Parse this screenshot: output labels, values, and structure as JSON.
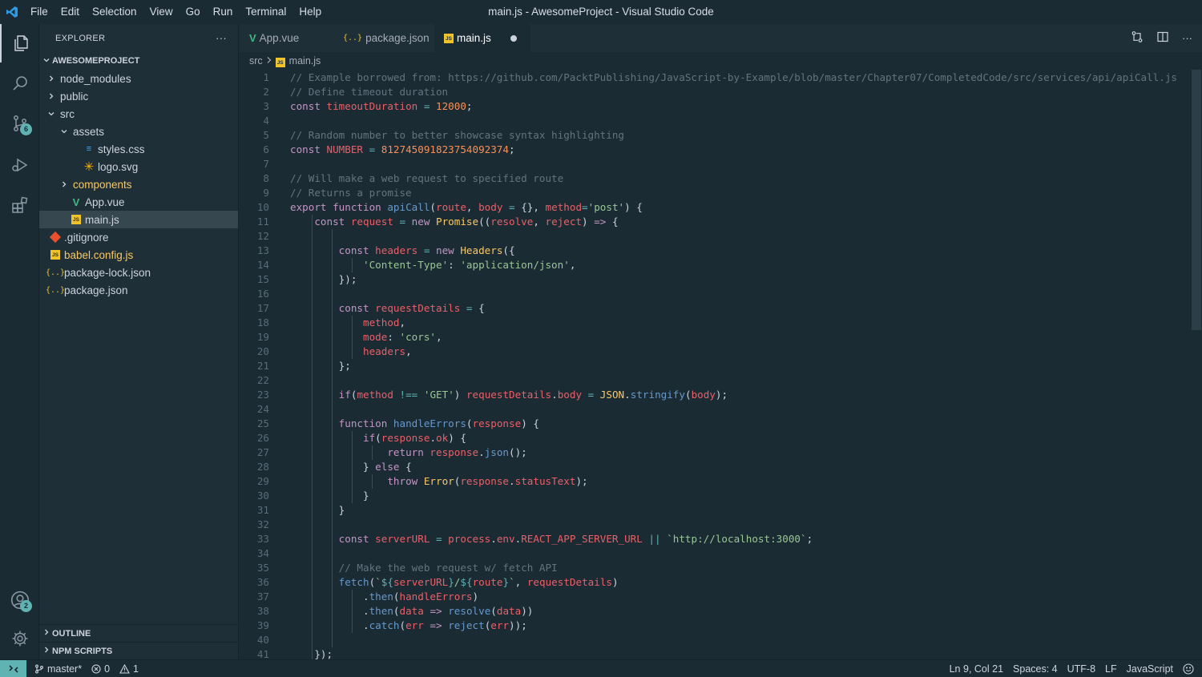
{
  "titlebar": {
    "window_title": "main.js - AwesomeProject - Visual Studio Code",
    "menu": [
      "File",
      "Edit",
      "Selection",
      "View",
      "Go",
      "Run",
      "Terminal",
      "Help"
    ]
  },
  "activity": {
    "scm_badge": "6",
    "accounts_badge": "2"
  },
  "sidebar": {
    "title": "EXPLORER",
    "more_label": "···",
    "project": "AWESOMEPROJECT",
    "tree": [
      {
        "label": "node_modules",
        "kind": "folder-closed",
        "depth": 1,
        "icon": "none"
      },
      {
        "label": "public",
        "kind": "folder-closed",
        "depth": 1,
        "icon": "none"
      },
      {
        "label": "src",
        "kind": "folder-open",
        "depth": 1,
        "icon": "none"
      },
      {
        "label": "assets",
        "kind": "folder-open",
        "depth": 2,
        "icon": "none"
      },
      {
        "label": "styles.css",
        "kind": "file",
        "depth": 3,
        "icon": "css"
      },
      {
        "label": "logo.svg",
        "kind": "file",
        "depth": 3,
        "icon": "svg"
      },
      {
        "label": "components",
        "kind": "folder-closed",
        "depth": 2,
        "icon": "none",
        "color": "#fac863"
      },
      {
        "label": "App.vue",
        "kind": "file",
        "depth": 2,
        "icon": "vue"
      },
      {
        "label": "main.js",
        "kind": "file",
        "depth": 2,
        "icon": "js",
        "selected": true
      },
      {
        "label": ".gitignore",
        "kind": "file",
        "depth": 1,
        "icon": "git"
      },
      {
        "label": "babel.config.js",
        "kind": "file",
        "depth": 1,
        "icon": "js",
        "color": "#fac863"
      },
      {
        "label": "package-lock.json",
        "kind": "file",
        "depth": 1,
        "icon": "json"
      },
      {
        "label": "package.json",
        "kind": "file",
        "depth": 1,
        "icon": "json"
      }
    ],
    "outline_label": "OUTLINE",
    "npm_label": "NPM SCRIPTS"
  },
  "tabs": [
    {
      "label": "App.vue",
      "icon": "vue",
      "active": false
    },
    {
      "label": "package.json",
      "icon": "json",
      "active": false
    },
    {
      "label": "main.js",
      "icon": "js",
      "active": true,
      "dirty": true
    }
  ],
  "breadcrumb": {
    "folder": "src",
    "file": "main.js"
  },
  "code": [
    [
      [
        "c-comment",
        "// Example borrowed from: https://github.com/PacktPublishing/JavaScript-by-Example/blob/master/Chapter07/CompletedCode/src/services/api/apiCall.js"
      ]
    ],
    [
      [
        "c-comment",
        "// Define timeout duration"
      ]
    ],
    [
      [
        "c-kw",
        "const "
      ],
      [
        "c-var",
        "timeoutDuration"
      ],
      [
        "c-op",
        " = "
      ],
      [
        "c-num",
        "12000"
      ],
      [
        "c-punc",
        ";"
      ]
    ],
    [],
    [
      [
        "c-comment",
        "// Random number to better showcase syntax highlighting"
      ]
    ],
    [
      [
        "c-kw",
        "const "
      ],
      [
        "c-var",
        "NUMBER"
      ],
      [
        "c-op",
        " = "
      ],
      [
        "c-num",
        "812745091823754092374"
      ],
      [
        "c-punc",
        ";"
      ]
    ],
    [],
    [
      [
        "c-comment",
        "// Will make a web request to specified route"
      ]
    ],
    [
      [
        "c-comment",
        "// Returns a promise"
      ]
    ],
    [
      [
        "c-kw",
        "export function "
      ],
      [
        "c-fn",
        "apiCall"
      ],
      [
        "c-punc",
        "("
      ],
      [
        "c-var",
        "route"
      ],
      [
        "c-punc",
        ", "
      ],
      [
        "c-var",
        "body"
      ],
      [
        "c-op",
        " = "
      ],
      [
        "c-punc",
        "{}, "
      ],
      [
        "c-var",
        "method"
      ],
      [
        "c-op",
        "="
      ],
      [
        "c-str",
        "'post'"
      ],
      [
        "c-punc",
        ") {"
      ]
    ],
    [
      [
        "c-punc",
        "    "
      ],
      [
        "c-kw",
        "const "
      ],
      [
        "c-var",
        "request"
      ],
      [
        "c-op",
        " = "
      ],
      [
        "c-kw",
        "new "
      ],
      [
        "c-cls",
        "Promise"
      ],
      [
        "c-punc",
        "(("
      ],
      [
        "c-var",
        "resolve"
      ],
      [
        "c-punc",
        ", "
      ],
      [
        "c-var",
        "reject"
      ],
      [
        "c-punc",
        ") "
      ],
      [
        "c-kw",
        "=>"
      ],
      [
        "c-punc",
        " {"
      ]
    ],
    [],
    [
      [
        "c-punc",
        "        "
      ],
      [
        "c-kw",
        "const "
      ],
      [
        "c-var",
        "headers"
      ],
      [
        "c-op",
        " = "
      ],
      [
        "c-kw",
        "new "
      ],
      [
        "c-cls",
        "Headers"
      ],
      [
        "c-punc",
        "({"
      ]
    ],
    [
      [
        "c-punc",
        "            "
      ],
      [
        "c-str",
        "'Content-Type'"
      ],
      [
        "c-punc",
        ": "
      ],
      [
        "c-str",
        "'application/json'"
      ],
      [
        "c-punc",
        ","
      ]
    ],
    [
      [
        "c-punc",
        "        });"
      ]
    ],
    [],
    [
      [
        "c-punc",
        "        "
      ],
      [
        "c-kw",
        "const "
      ],
      [
        "c-var",
        "requestDetails"
      ],
      [
        "c-op",
        " = "
      ],
      [
        "c-punc",
        "{"
      ]
    ],
    [
      [
        "c-punc",
        "            "
      ],
      [
        "c-var",
        "method"
      ],
      [
        "c-punc",
        ","
      ]
    ],
    [
      [
        "c-punc",
        "            "
      ],
      [
        "c-var",
        "mode"
      ],
      [
        "c-punc",
        ": "
      ],
      [
        "c-str",
        "'cors'"
      ],
      [
        "c-punc",
        ","
      ]
    ],
    [
      [
        "c-punc",
        "            "
      ],
      [
        "c-var",
        "headers"
      ],
      [
        "c-punc",
        ","
      ]
    ],
    [
      [
        "c-punc",
        "        };"
      ]
    ],
    [],
    [
      [
        "c-punc",
        "        "
      ],
      [
        "c-kw",
        "if"
      ],
      [
        "c-punc",
        "("
      ],
      [
        "c-var",
        "method"
      ],
      [
        "c-op",
        " !== "
      ],
      [
        "c-str",
        "'GET'"
      ],
      [
        "c-punc",
        ") "
      ],
      [
        "c-var",
        "requestDetails"
      ],
      [
        "c-punc",
        "."
      ],
      [
        "c-var",
        "body"
      ],
      [
        "c-op",
        " = "
      ],
      [
        "c-cls",
        "JSON"
      ],
      [
        "c-punc",
        "."
      ],
      [
        "c-fn",
        "stringify"
      ],
      [
        "c-punc",
        "("
      ],
      [
        "c-var",
        "body"
      ],
      [
        "c-punc",
        ");"
      ]
    ],
    [],
    [
      [
        "c-punc",
        "        "
      ],
      [
        "c-kw",
        "function "
      ],
      [
        "c-fn",
        "handleErrors"
      ],
      [
        "c-punc",
        "("
      ],
      [
        "c-var",
        "response"
      ],
      [
        "c-punc",
        ") {"
      ]
    ],
    [
      [
        "c-punc",
        "            "
      ],
      [
        "c-kw",
        "if"
      ],
      [
        "c-punc",
        "("
      ],
      [
        "c-var",
        "response"
      ],
      [
        "c-punc",
        "."
      ],
      [
        "c-var",
        "ok"
      ],
      [
        "c-punc",
        ") {"
      ]
    ],
    [
      [
        "c-punc",
        "                "
      ],
      [
        "c-kw",
        "return "
      ],
      [
        "c-var",
        "response"
      ],
      [
        "c-punc",
        "."
      ],
      [
        "c-fn",
        "json"
      ],
      [
        "c-punc",
        "();"
      ]
    ],
    [
      [
        "c-punc",
        "            } "
      ],
      [
        "c-kw",
        "else"
      ],
      [
        "c-punc",
        " {"
      ]
    ],
    [
      [
        "c-punc",
        "                "
      ],
      [
        "c-kw",
        "throw "
      ],
      [
        "c-cls",
        "Error"
      ],
      [
        "c-punc",
        "("
      ],
      [
        "c-var",
        "response"
      ],
      [
        "c-punc",
        "."
      ],
      [
        "c-var",
        "statusText"
      ],
      [
        "c-punc",
        ");"
      ]
    ],
    [
      [
        "c-punc",
        "            }"
      ]
    ],
    [
      [
        "c-punc",
        "        }"
      ]
    ],
    [],
    [
      [
        "c-punc",
        "        "
      ],
      [
        "c-kw",
        "const "
      ],
      [
        "c-var",
        "serverURL"
      ],
      [
        "c-op",
        " = "
      ],
      [
        "c-var",
        "process"
      ],
      [
        "c-punc",
        "."
      ],
      [
        "c-var",
        "env"
      ],
      [
        "c-punc",
        "."
      ],
      [
        "c-var",
        "REACT_APP_SERVER_URL"
      ],
      [
        "c-op",
        " || "
      ],
      [
        "c-str",
        "`http://localhost:3000`"
      ],
      [
        "c-punc",
        ";"
      ]
    ],
    [],
    [
      [
        "c-punc",
        "        "
      ],
      [
        "c-comment",
        "// Make the web request w/ fetch API"
      ]
    ],
    [
      [
        "c-punc",
        "        "
      ],
      [
        "c-fn",
        "fetch"
      ],
      [
        "c-punc",
        "("
      ],
      [
        "c-str",
        "`"
      ],
      [
        "c-op",
        "${"
      ],
      [
        "c-var",
        "serverURL"
      ],
      [
        "c-op",
        "}"
      ],
      [
        "c-str",
        "/"
      ],
      [
        "c-op",
        "${"
      ],
      [
        "c-var",
        "route"
      ],
      [
        "c-op",
        "}"
      ],
      [
        "c-str",
        "`"
      ],
      [
        "c-punc",
        ", "
      ],
      [
        "c-var",
        "requestDetails"
      ],
      [
        "c-punc",
        ")"
      ]
    ],
    [
      [
        "c-punc",
        "            ."
      ],
      [
        "c-fn",
        "then"
      ],
      [
        "c-punc",
        "("
      ],
      [
        "c-var",
        "handleErrors"
      ],
      [
        "c-punc",
        ")"
      ]
    ],
    [
      [
        "c-punc",
        "            ."
      ],
      [
        "c-fn",
        "then"
      ],
      [
        "c-punc",
        "("
      ],
      [
        "c-var",
        "data"
      ],
      [
        "c-kw",
        " => "
      ],
      [
        "c-fn",
        "resolve"
      ],
      [
        "c-punc",
        "("
      ],
      [
        "c-var",
        "data"
      ],
      [
        "c-punc",
        "))"
      ]
    ],
    [
      [
        "c-punc",
        "            ."
      ],
      [
        "c-fn",
        "catch"
      ],
      [
        "c-punc",
        "("
      ],
      [
        "c-var",
        "err"
      ],
      [
        "c-kw",
        " => "
      ],
      [
        "c-fn",
        "reject"
      ],
      [
        "c-punc",
        "("
      ],
      [
        "c-var",
        "err"
      ],
      [
        "c-punc",
        "));"
      ]
    ],
    [],
    [
      [
        "c-punc",
        "    });"
      ]
    ]
  ],
  "statusbar": {
    "branch": "master*",
    "errors": "0",
    "warnings": "1",
    "position": "Ln 9, Col 21",
    "spaces": "Spaces: 4",
    "encoding": "UTF-8",
    "eol": "LF",
    "language": "JavaScript"
  },
  "colors": {
    "accent": "#5fb3b3",
    "background": "#1b2b34",
    "sidebar": "#1e2f38",
    "selection": "#37474f"
  }
}
